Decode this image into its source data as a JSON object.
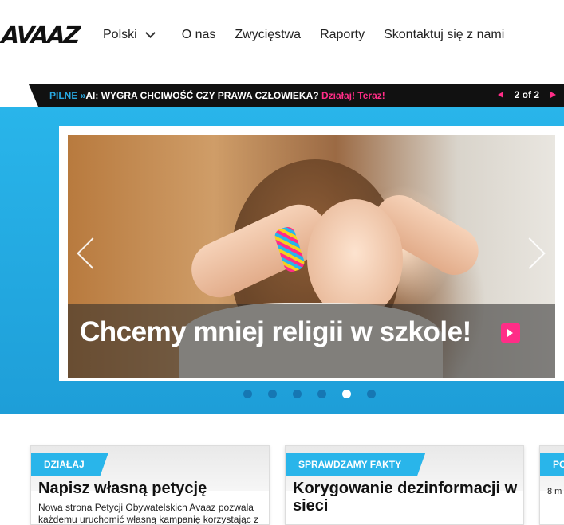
{
  "header": {
    "logo": "AVAAZ",
    "nav": {
      "language": "Polski",
      "about": "O nas",
      "victories": "Zwycięstwa",
      "reports": "Raporty",
      "contact": "Skontaktuj się z nami"
    }
  },
  "ticker": {
    "label": "PILNE",
    "arrow": "»",
    "headline": "AI: WYGRA CHCIWOŚĆ CZY PRAWA CZŁOWIEKA?",
    "cta": "Działaj! Teraz!",
    "counter": "2 of 2"
  },
  "hero": {
    "caption": "Chcemy mniej religii w szkole!",
    "slides_total": 6,
    "active_slide": 5
  },
  "cards": [
    {
      "tag": "DZIAŁAJ",
      "title": "Napisz własną petycję",
      "description": "Nowa strona Petycji Obywatelskich Avaaz pozwala każdemu uruchomić własną kampanię korzystając z"
    },
    {
      "tag": "SPRAWDZAMY FAKTY",
      "title": "Korygowanie dezinformacji w sieci",
      "description": ""
    },
    {
      "tag": "PO",
      "title": "",
      "description": "8 m"
    }
  ],
  "colors": {
    "accent_blue": "#29b5ea",
    "accent_pink": "#ff2d87",
    "ticker_bg": "#111111"
  }
}
